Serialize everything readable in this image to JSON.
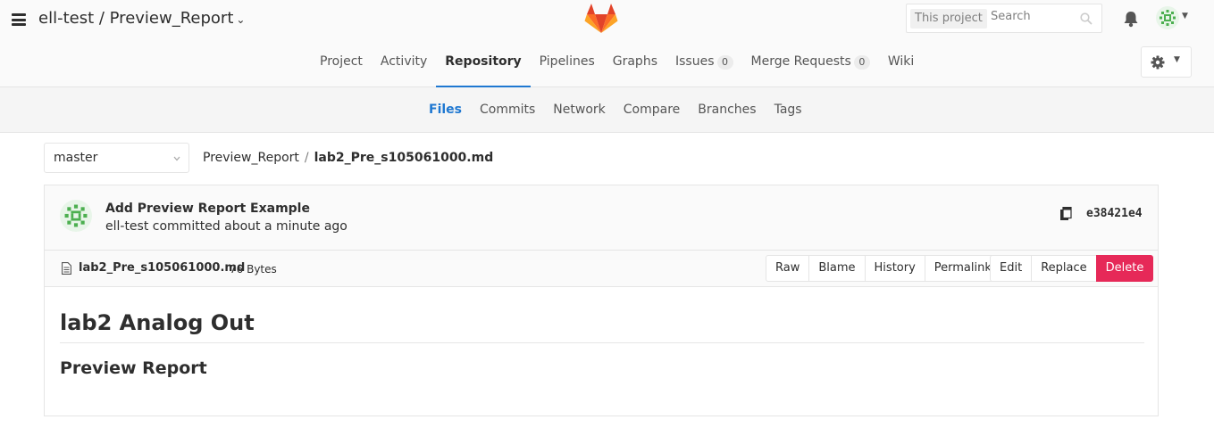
{
  "header": {
    "project_path": "ell-test / Preview_Report",
    "search": {
      "scope": "This project",
      "placeholder": "Search"
    }
  },
  "nav": {
    "project": "Project",
    "activity": "Activity",
    "repository": "Repository",
    "pipelines": "Pipelines",
    "graphs": "Graphs",
    "issues": "Issues",
    "issues_count": "0",
    "merge_requests": "Merge Requests",
    "merge_requests_count": "0",
    "wiki": "Wiki"
  },
  "subnav": {
    "files": "Files",
    "commits": "Commits",
    "network": "Network",
    "compare": "Compare",
    "branches": "Branches",
    "tags": "Tags"
  },
  "branch": {
    "selected": "master"
  },
  "breadcrumb": {
    "project": "Preview_Report",
    "separator": "/",
    "file": "lab2_Pre_s105061000.md"
  },
  "commit": {
    "message": "Add Preview Report Example",
    "meta": "ell-test committed about a minute ago",
    "sha": "e38421e4"
  },
  "file": {
    "name": "lab2_Pre_s105061000.md",
    "size": "76 Bytes",
    "buttons": {
      "raw": "Raw",
      "blame": "Blame",
      "history": "History",
      "permalink": "Permalink",
      "edit": "Edit",
      "replace": "Replace",
      "delete": "Delete"
    }
  },
  "markdown": {
    "h1": "lab2 Analog Out",
    "h2": "Preview Report"
  },
  "colors": {
    "accent": "#1f78d1",
    "danger": "#e62958",
    "avatar": "#4caf50"
  }
}
